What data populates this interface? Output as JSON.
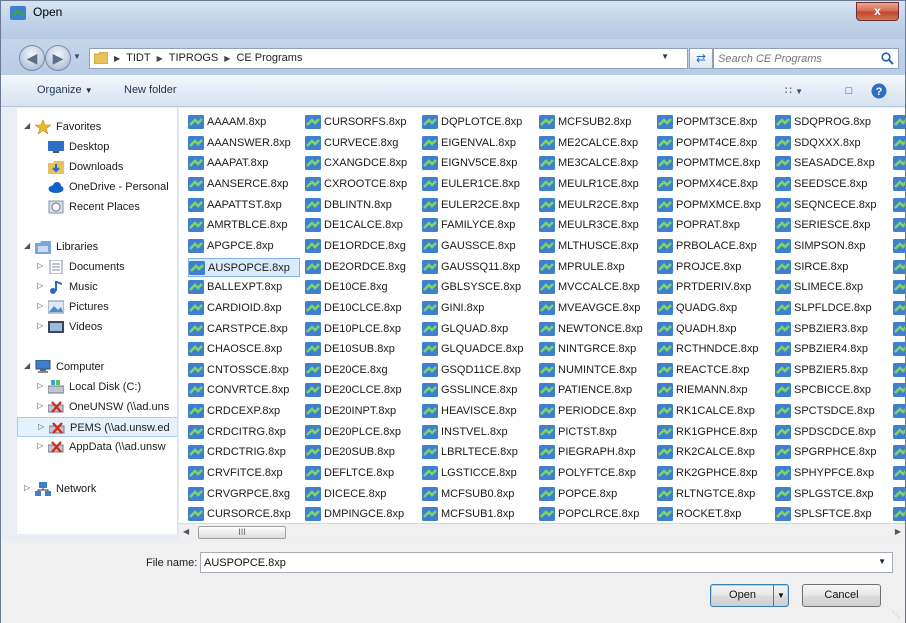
{
  "window": {
    "title": "Open",
    "close_label": "x"
  },
  "address": {
    "crumbs": [
      "TIDT",
      "TIPROGS",
      "CE Programs"
    ],
    "search_placeholder": "Search CE Programs"
  },
  "toolbar": {
    "organize": "Organize",
    "new_folder": "New folder"
  },
  "sidebar": {
    "items": [
      {
        "label": "Favorites",
        "icon": "star-icon",
        "kind": "header",
        "expanded": true
      },
      {
        "label": "Desktop",
        "icon": "desktop-icon",
        "kind": "child"
      },
      {
        "label": "Downloads",
        "icon": "downloads-icon",
        "kind": "child"
      },
      {
        "label": "OneDrive - Personal",
        "icon": "cloud-icon",
        "kind": "child"
      },
      {
        "label": "Recent Places",
        "icon": "recent-places-icon",
        "kind": "child"
      },
      {
        "label": "Libraries",
        "icon": "libraries-icon",
        "kind": "header",
        "expanded": true
      },
      {
        "label": "Documents",
        "icon": "documents-icon",
        "kind": "child-expander"
      },
      {
        "label": "Music",
        "icon": "music-icon",
        "kind": "child-expander"
      },
      {
        "label": "Pictures",
        "icon": "pictures-icon",
        "kind": "child-expander"
      },
      {
        "label": "Videos",
        "icon": "videos-icon",
        "kind": "child-expander"
      },
      {
        "label": "Computer",
        "icon": "computer-icon",
        "kind": "header",
        "expanded": true
      },
      {
        "label": "Local Disk (C:)",
        "icon": "local-disk-icon",
        "kind": "child-expander"
      },
      {
        "label": "OneUNSW (\\\\ad.uns",
        "icon": "network-drive-disconnected-icon",
        "kind": "child-expander"
      },
      {
        "label": "PEMS (\\\\ad.unsw.ed",
        "icon": "network-drive-disconnected-icon",
        "kind": "child-expander",
        "selected": true
      },
      {
        "label": "AppData (\\\\ad.unsw",
        "icon": "network-drive-disconnected-icon",
        "kind": "child-expander"
      },
      {
        "label": "Network",
        "icon": "network-icon",
        "kind": "header",
        "expanded": false
      }
    ]
  },
  "files": {
    "columns": [
      [
        "AAAAM.8xp",
        "AAANSWER.8xp",
        "AAAPAT.8xp",
        "AANSERCE.8xp",
        "AAPATTST.8xp",
        "AMRTBLCE.8xp",
        "APGPCE.8xp",
        "AUSPOPCE.8xp",
        "BALLEXPT.8xp",
        "CARDIOID.8xp",
        "CARSTPCE.8xp",
        "CHAOSCE.8xp",
        "CNTOSSCE.8xp",
        "CONVRTCE.8xp",
        "CRDCEXP.8xp",
        "CRDCITRG.8xp",
        "CRDCTRIG.8xp",
        "CRVFITCE.8xp",
        "CRVGRPCE.8xg",
        "CURSORCE.8xp"
      ],
      [
        "CURSORFS.8xp",
        "CURVECE.8xg",
        "CXANGDCE.8xp",
        "CXROOTCE.8xp",
        "DBLINTN.8xp",
        "DE1CALCE.8xp",
        "DE1ORDCE.8xg",
        "DE2ORDCE.8xg",
        "DE10CE.8xg",
        "DE10CLCE.8xp",
        "DE10PLCE.8xp",
        "DE10SUB.8xp",
        "DE20CE.8xg",
        "DE20CLCE.8xp",
        "DE20INPT.8xp",
        "DE20PLCE.8xp",
        "DE20SUB.8xp",
        "DEFLTCE.8xp",
        "DICECE.8xp",
        "DMPINGCE.8xp"
      ],
      [
        "DQPLOTCE.8xp",
        "EIGENVAL.8xp",
        "EIGNV5CE.8xp",
        "EULER1CE.8xp",
        "EULER2CE.8xp",
        "FAMILYCE.8xp",
        "GAUSSCE.8xp",
        "GAUSSQ11.8xp",
        "GBLSYSCE.8xp",
        "GINI.8xp",
        "GLQUAD.8xp",
        "GLQUADCE.8xp",
        "GSQD11CE.8xp",
        "GSSLINCE.8xp",
        "HEAVISCE.8xp",
        "INSTVEL.8xp",
        "LBRLTECE.8xp",
        "LGSTICCE.8xp",
        "MCFSUB0.8xp",
        "MCFSUB1.8xp"
      ],
      [
        "MCFSUB2.8xp",
        "ME2CALCE.8xp",
        "ME3CALCE.8xp",
        "MEULR1CE.8xp",
        "MEULR2CE.8xp",
        "MEULR3CE.8xp",
        "MLTHUSCE.8xp",
        "MPRULE.8xp",
        "MVCCALCE.8xp",
        "MVEAVGCE.8xp",
        "NEWTONCE.8xp",
        "NINTGRCE.8xp",
        "NUMINTCE.8xp",
        "PATIENCE.8xp",
        "PERIODCE.8xp",
        "PICTST.8xp",
        "PIEGRAPH.8xp",
        "POLYFTCE.8xp",
        "POPCE.8xp",
        "POPCLRCE.8xp"
      ],
      [
        "POPMT3CE.8xp",
        "POPMT4CE.8xp",
        "POPMTMCE.8xp",
        "POPMX4CE.8xp",
        "POPMXMCE.8xp",
        "POPRAT.8xp",
        "PRBOLACE.8xp",
        "PROJCE.8xp",
        "PRTDERIV.8xp",
        "QUADG.8xp",
        "QUADH.8xp",
        "RCTHNDCE.8xp",
        "REACTCE.8xp",
        "RIEMANN.8xp",
        "RK1CALCE.8xp",
        "RK1GPHCE.8xp",
        "RK2CALCE.8xp",
        "RK2GPHCE.8xp",
        "RLTNGTCE.8xp",
        "ROCKET.8xp"
      ],
      [
        "SDQPROG.8xp",
        "SDQXXX.8xp",
        "SEASADCE.8xp",
        "SEEDSCE.8xp",
        "SEQNCECE.8xp",
        "SERIESCE.8xp",
        "SIMPSON.8xp",
        "SIRCE.8xp",
        "SLIMECE.8xp",
        "SLPFLDCE.8xp",
        "SPBZIER3.8xp",
        "SPBZIER4.8xp",
        "SPBZIER5.8xp",
        "SPCBICCE.8xp",
        "SPCTSDCE.8xp",
        "SPDSCDCE.8xp",
        "SPGRPHCE.8xp",
        "SPHYPFCE.8xp",
        "SPLGSTCE.8xp",
        "SPLSFTCE.8xp"
      ]
    ],
    "selected": "AUSPOPCE.8xp"
  },
  "scrollbar": {
    "thumb_grip": "III"
  },
  "bottom": {
    "filename_label": "File name:",
    "filename_value": "AUSPOPCE.8xp",
    "open_label": "Open",
    "cancel_label": "Cancel"
  },
  "colors": {
    "icon_blue": "#3f7fcf",
    "icon_green": "#3aa64a",
    "selection": "#dcebfc"
  }
}
